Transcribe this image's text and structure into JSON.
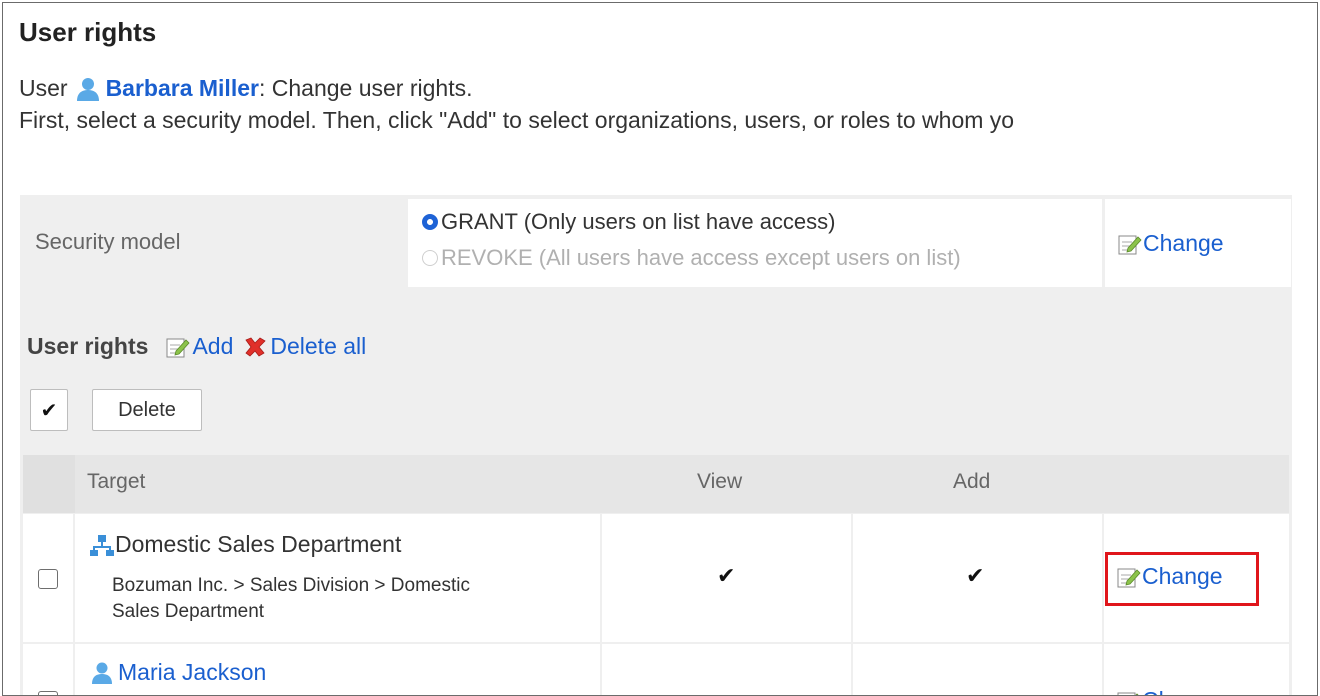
{
  "page": {
    "title": "User rights",
    "user_prefix": "User",
    "user_name": "Barbara Miller",
    "user_suffix": ": Change user rights.",
    "instructions": "First, select a security model. Then, click \"Add\" to select organizations, users, or roles to whom yo"
  },
  "security_model": {
    "label": "Security model",
    "options": [
      {
        "label": "GRANT (Only users on list have access)",
        "selected": true
      },
      {
        "label": "REVOKE (All users have access except users on list)",
        "selected": false
      }
    ],
    "change_label": "Change"
  },
  "user_rights": {
    "heading": "User rights",
    "add_label": "Add",
    "delete_all_label": "Delete all",
    "select_all_glyph": "✔",
    "delete_button": "Delete",
    "columns": [
      "Target",
      "View",
      "Add"
    ],
    "rows": [
      {
        "type": "organization",
        "name": "Domestic Sales Department",
        "path_line1": "Bozuman Inc. > Sales Division > Domestic",
        "path_line2": "Sales Department",
        "view": "✔",
        "add": "✔",
        "change_label": "Change",
        "highlighted": true
      },
      {
        "type": "user",
        "name": "Maria Jackson",
        "change_label": "Change"
      }
    ]
  },
  "colors": {
    "link": "#1a5fcf",
    "highlight": "#e0151b",
    "panel": "#efefef",
    "header": "#e0e0e0"
  },
  "icons": [
    "user-icon",
    "edit-icon",
    "delete-icon",
    "organization-icon"
  ]
}
